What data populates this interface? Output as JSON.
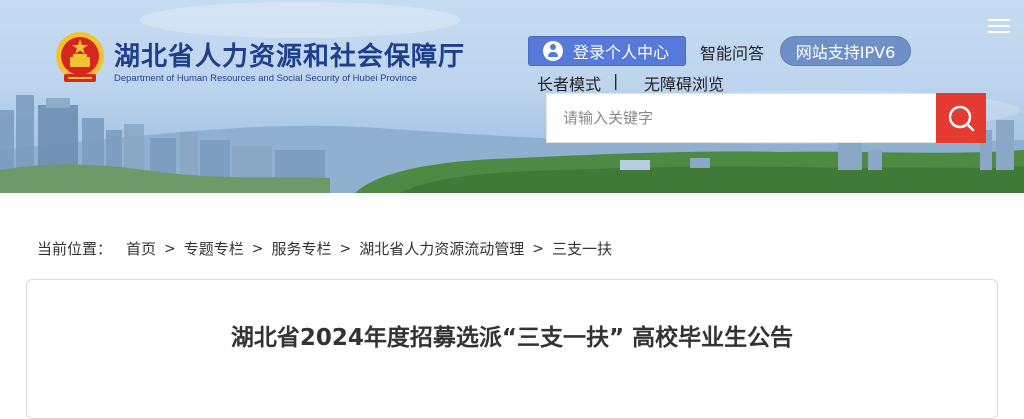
{
  "header": {
    "site_title": "湖北省人力资源和社会保障厅",
    "site_subtitle": "Department of Human Resources and Social Security of Hubei Province",
    "login_label": "登录个人中心",
    "ai_label": "智能问答",
    "ipv6_label": "网站支持IPV6",
    "elder_label": "长者模式",
    "separator": "|",
    "access_label": "无障碍浏览",
    "search_placeholder": "请输入关键字"
  },
  "breadcrumb": {
    "label": "当前位置：",
    "items": [
      "首页",
      "专题专栏",
      "服务专栏",
      "湖北省人力资源流动管理",
      "三支一扶"
    ],
    "separator": ">"
  },
  "article": {
    "title": "湖北省2024年度招募选派“三支一扶” 高校毕业生公告"
  },
  "colors": {
    "title_blue": "#1f3f8a",
    "login_bg": "#5779d8",
    "ipv6_bg": "#6f90c6",
    "search_btn_bg": "#e53a2f"
  },
  "icons": [
    "national-emblem-icon",
    "user-icon",
    "search-icon",
    "menu-icon"
  ]
}
